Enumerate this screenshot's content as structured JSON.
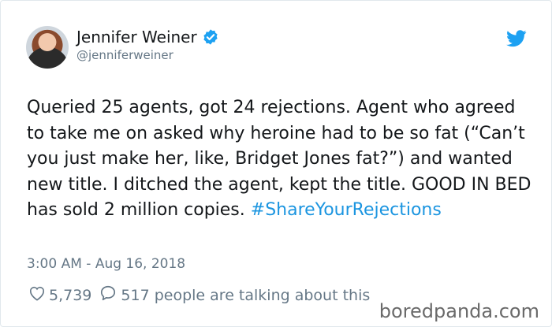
{
  "tweet": {
    "author_name": "Jennifer Weiner",
    "author_handle": "@jenniferweiner",
    "text_main": "Queried 25 agents, got 24 rejections. Agent who agreed to take me on asked why heroine had to be so fat (“Can’t you just make her, like, Bridget Jones fat?”) and wanted new title. I ditched the agent, kept the title. GOOD IN BED has sold 2 million copies. ",
    "hashtag": "#ShareYourRejections",
    "timestamp": "3:00 AM - Aug 16, 2018",
    "likes": "5,739",
    "talking": "517 people are talking about this"
  },
  "icons": {
    "verified": "verified-badge-icon",
    "bird": "twitter-bird-icon",
    "heart": "heart-icon",
    "reply": "speech-bubble-icon"
  },
  "watermark": "boredpanda.com",
  "colors": {
    "hashtag": "#1b95e0",
    "verified": "#1da1f2",
    "muted": "#657786",
    "text": "#14171a"
  }
}
